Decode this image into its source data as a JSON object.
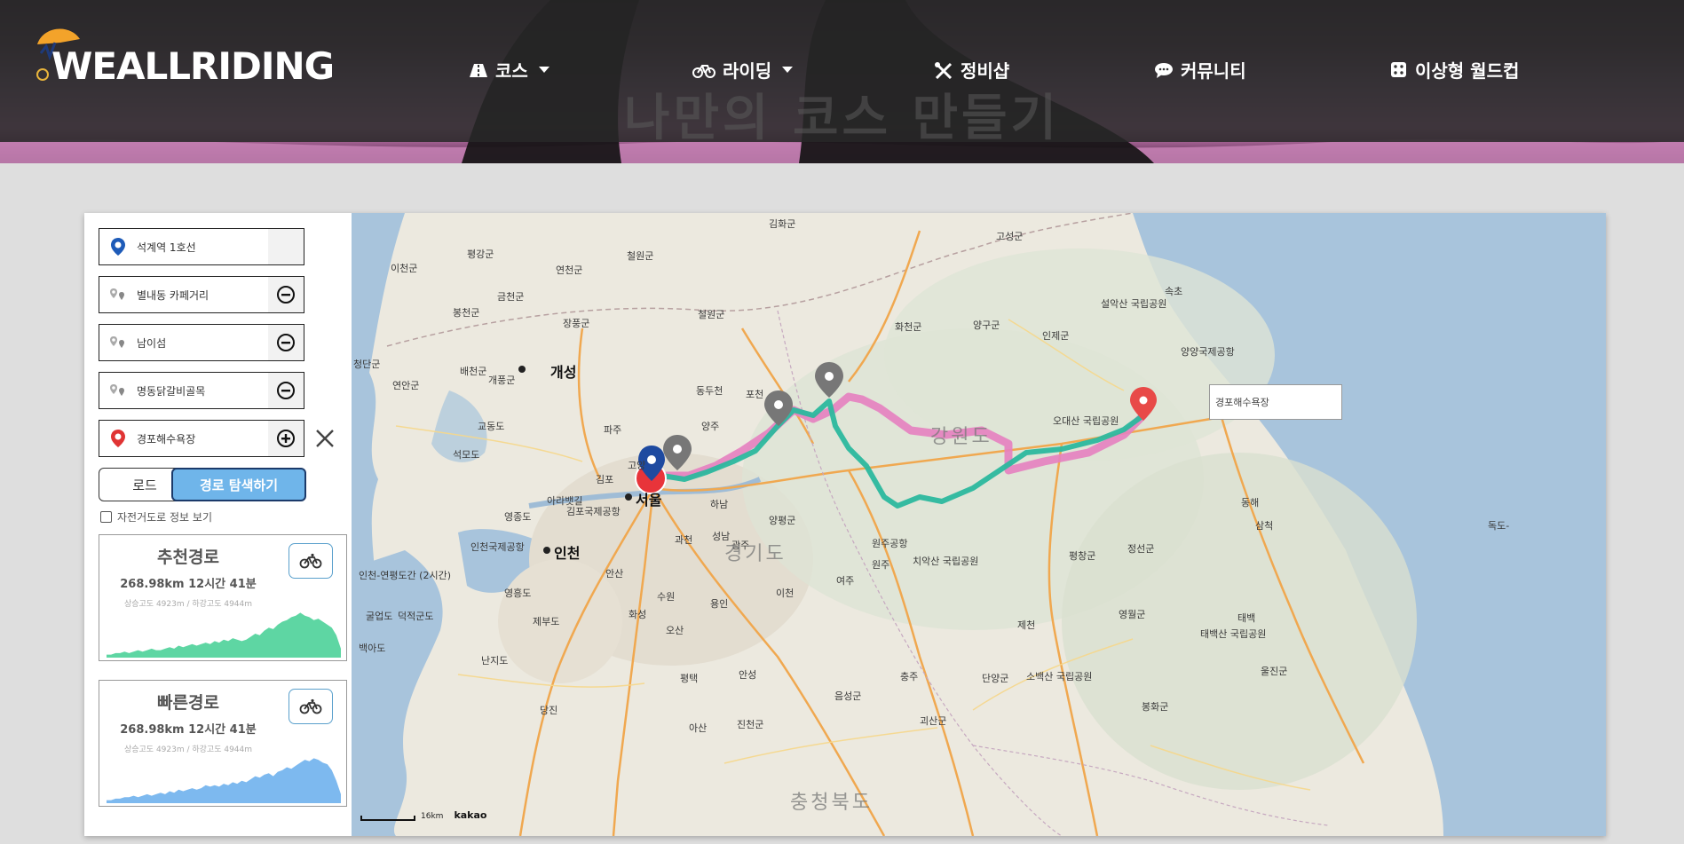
{
  "brand": {
    "logo_text": "WEALLRIDING"
  },
  "hero": {
    "title": "나만의 코스 만들기"
  },
  "nav": [
    {
      "label": "코스",
      "icon": "road-icon",
      "dropdown": true
    },
    {
      "label": "라이딩",
      "icon": "bicycle-icon",
      "dropdown": true
    },
    {
      "label": "정비샵",
      "icon": "tools-icon",
      "dropdown": false
    },
    {
      "label": "커뮤니티",
      "icon": "chat-icon",
      "dropdown": false
    },
    {
      "label": "이상형 월드컵",
      "icon": "dice-icon",
      "dropdown": false
    }
  ],
  "waypoints": [
    {
      "name": "석계역 1호선",
      "type": "start"
    },
    {
      "name": "별내동 카페거리",
      "type": "via"
    },
    {
      "name": "남이섬",
      "type": "via"
    },
    {
      "name": "명동닭갈비골목",
      "type": "via"
    },
    {
      "name": "경포해수욕장",
      "type": "end"
    }
  ],
  "buttons": {
    "load": "로드",
    "search": "경로 탐색하기"
  },
  "checkbox": {
    "label": "자전거도로 정보 보기",
    "checked": false
  },
  "routes": [
    {
      "title": "추천경로",
      "summary": "268.98km 12시간 41분",
      "elevation": "상승고도 4923m / 하강고도 4944m",
      "color": "#5ed6a3",
      "profile": [
        2,
        2,
        3,
        3,
        4,
        3,
        4,
        5,
        4,
        5,
        6,
        5,
        5,
        6,
        7,
        6,
        8,
        7,
        8,
        9,
        8,
        9,
        10,
        9,
        11,
        10,
        12,
        11,
        13,
        12,
        11,
        12,
        14,
        16,
        15,
        18,
        20,
        19,
        22,
        24,
        25,
        27,
        28,
        30,
        28,
        27,
        25,
        26,
        24,
        22,
        20,
        15,
        6
      ]
    },
    {
      "title": "빠른경로",
      "summary": "268.98km 12시간 41분",
      "elevation": "상승고도 4923m / 하강고도 4944m",
      "color": "#7db9ef",
      "profile": [
        2,
        2,
        3,
        3,
        4,
        4,
        5,
        4,
        5,
        6,
        5,
        6,
        7,
        6,
        8,
        7,
        9,
        8,
        9,
        10,
        9,
        10,
        12,
        11,
        12,
        11,
        13,
        12,
        14,
        13,
        15,
        14,
        16,
        18,
        17,
        19,
        20,
        18,
        21,
        22,
        24,
        23,
        25,
        27,
        29,
        28,
        30,
        29,
        27,
        26,
        22,
        15,
        6
      ]
    }
  ],
  "map": {
    "popup_label": "경포해수욕장",
    "scale_label": "16km",
    "provider": "kakao",
    "places": [
      {
        "t": "김화군"
      },
      {
        "t": "고성군"
      },
      {
        "t": "평강군"
      },
      {
        "t": "철원군"
      },
      {
        "t": "이천군"
      },
      {
        "t": "연천군"
      },
      {
        "t": "철원군"
      },
      {
        "t": "금천군"
      },
      {
        "t": "봉천군"
      },
      {
        "t": "장풍군"
      },
      {
        "t": "청단군"
      },
      {
        "t": "연안군"
      },
      {
        "t": "배천군"
      },
      {
        "t": "개풍군"
      },
      {
        "t": "속초"
      },
      {
        "t": "설악산 국립공원"
      },
      {
        "t": "인제군"
      },
      {
        "t": "양구군"
      },
      {
        "t": "화천군"
      },
      {
        "t": "양양국제공항"
      },
      {
        "t": "동두천"
      },
      {
        "t": "포천"
      },
      {
        "t": "양주"
      },
      {
        "t": "파주"
      },
      {
        "t": "고양"
      },
      {
        "t": "김포"
      },
      {
        "t": "교동도"
      },
      {
        "t": "석모도"
      },
      {
        "t": "하남"
      },
      {
        "t": "양평군"
      },
      {
        "t": "성남"
      },
      {
        "t": "과천"
      },
      {
        "t": "광주"
      },
      {
        "t": "안산"
      },
      {
        "t": "수원"
      },
      {
        "t": "용인"
      },
      {
        "t": "이천"
      },
      {
        "t": "여주"
      },
      {
        "t": "화성"
      },
      {
        "t": "오산"
      },
      {
        "t": "평택"
      },
      {
        "t": "안성"
      },
      {
        "t": "당진"
      },
      {
        "t": "아산"
      },
      {
        "t": "영흥도"
      },
      {
        "t": "제부도"
      },
      {
        "t": "백아도"
      },
      {
        "t": "덕적군도"
      },
      {
        "t": "굴업도"
      },
      {
        "t": "난지도"
      },
      {
        "t": "인천국제공항"
      },
      {
        "t": "영종도"
      },
      {
        "t": "김포국제공항"
      },
      {
        "t": "원주공항"
      },
      {
        "t": "원주"
      },
      {
        "t": "치악산 국립공원"
      },
      {
        "t": "제천"
      },
      {
        "t": "평창군"
      },
      {
        "t": "정선군"
      },
      {
        "t": "오대산 국립공원"
      },
      {
        "t": "동해"
      },
      {
        "t": "삼척"
      },
      {
        "t": "태백"
      },
      {
        "t": "태백산 국립공원"
      },
      {
        "t": "영월군"
      },
      {
        "t": "단양군"
      },
      {
        "t": "충주"
      },
      {
        "t": "음성군"
      },
      {
        "t": "진천군"
      },
      {
        "t": "괴산군"
      },
      {
        "t": "소백산 국립공원"
      },
      {
        "t": "봉화군"
      },
      {
        "t": "울진군"
      },
      {
        "t": "아라뱃길"
      },
      {
        "t": "인천-연평도간 (2시간)"
      },
      {
        "t": "독도-"
      }
    ],
    "big_places": [
      {
        "t": "개성"
      },
      {
        "t": "서울"
      },
      {
        "t": "인천"
      }
    ],
    "regions": [
      {
        "t": "강원도"
      },
      {
        "t": "경기도"
      },
      {
        "t": "충청북도"
      }
    ]
  }
}
